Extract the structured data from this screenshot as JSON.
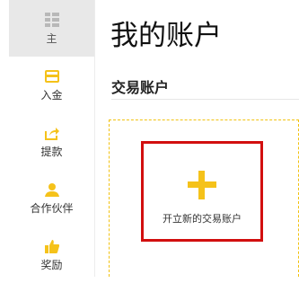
{
  "sidebar": {
    "items": [
      {
        "label": "主",
        "icon": "dashboard-icon",
        "active": true
      },
      {
        "label": "入金",
        "icon": "card-icon"
      },
      {
        "label": "提款",
        "icon": "share-icon"
      },
      {
        "label": "合作伙伴",
        "icon": "user-icon"
      },
      {
        "label": "奖励",
        "icon": "thumbs-up-icon"
      }
    ]
  },
  "main": {
    "title": "我的账户",
    "section_title": "交易账户",
    "new_account_label": "开立新的交易账户"
  },
  "colors": {
    "accent": "#f5c21a",
    "highlight_border": "#d20f0f",
    "active_bg": "#e8e8e8"
  }
}
